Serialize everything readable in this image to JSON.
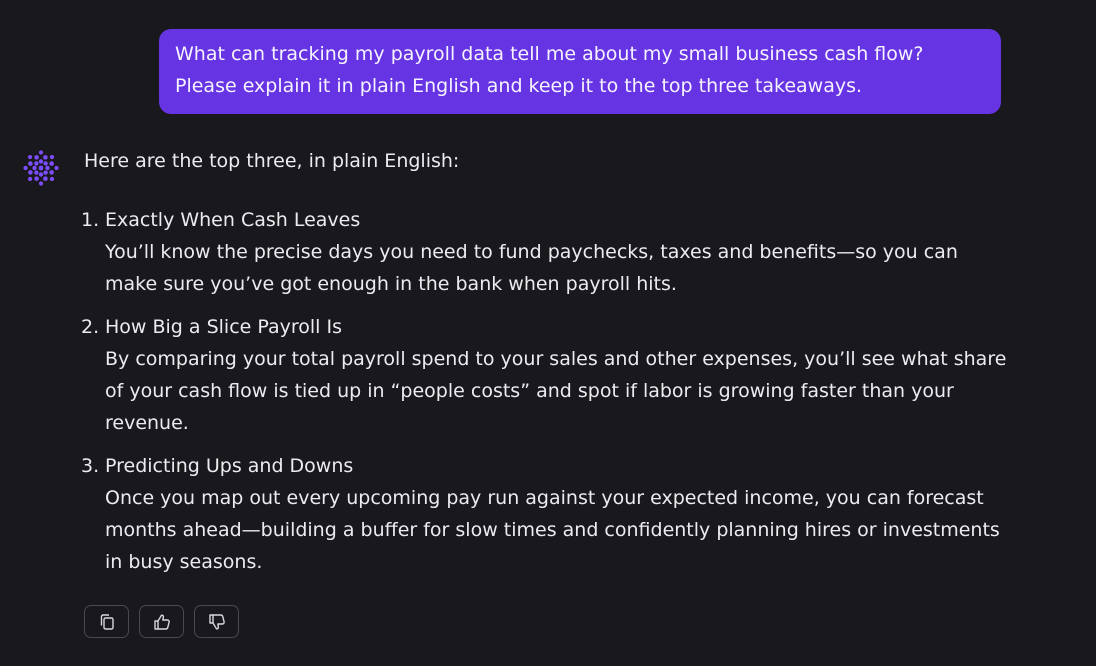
{
  "user_message": {
    "lines": [
      "What can tracking my payroll data tell me about my small business cash flow?",
      "Please explain it in plain English and keep it to the top three takeaways."
    ]
  },
  "assistant": {
    "intro": "Here are the top three, in plain English:",
    "takeaways": [
      {
        "number": "1.",
        "title": "Exactly When Cash Leaves",
        "body_lines": [
          "You’ll know the precise days you need to fund paychecks, taxes and benefits—so you can",
          "make sure you’ve got enough in the bank when payroll hits."
        ]
      },
      {
        "number": "2.",
        "title": "How Big a Slice Payroll Is",
        "body_lines": [
          "By comparing your total payroll spend to your sales and other expenses, you’ll see what share",
          "of your cash flow is tied up in “people costs” and spot if labor is growing faster than your",
          "revenue."
        ]
      },
      {
        "number": "3.",
        "title": "Predicting Ups and Downs",
        "body_lines": [
          "Once you map out every upcoming pay run against your expected income, you can forecast",
          "months ahead—building a buffer for slow times and confidently planning hires or investments",
          "in busy seasons."
        ]
      }
    ]
  },
  "actions": [
    {
      "name": "copy-button",
      "icon": "copy-icon"
    },
    {
      "name": "thumbs-up-button",
      "icon": "thumbs-up-icon"
    },
    {
      "name": "thumbs-down-button",
      "icon": "thumbs-down-icon"
    }
  ],
  "colors": {
    "background": "#19181c",
    "user_bubble": "#6634e2",
    "accent": "#7c4dff",
    "text": "#ecebef"
  }
}
